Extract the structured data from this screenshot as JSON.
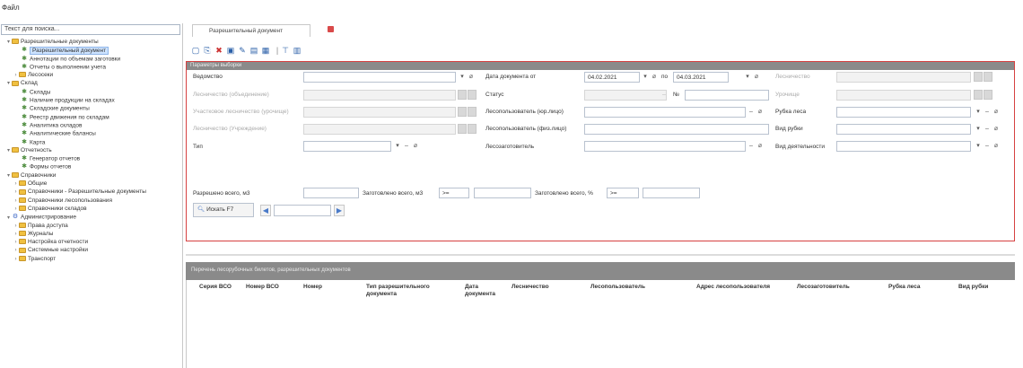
{
  "menu": {
    "file": "Файл"
  },
  "tree": {
    "search_placeholder": "Текст для поиска...",
    "items": [
      {
        "label": "Разрешительные документы",
        "type": "folder",
        "toggle": "▾"
      },
      {
        "label": "Разрешительный документ",
        "type": "page",
        "toggle": "",
        "selected": true
      },
      {
        "label": "Аннотации по объемам заготовки",
        "type": "page",
        "toggle": ""
      },
      {
        "label": "Отчеты о выполнении учета",
        "type": "page",
        "toggle": ""
      },
      {
        "label": "Лесосеки",
        "type": "folder",
        "toggle": "›"
      },
      {
        "label": "Склад",
        "type": "folder",
        "toggle": "▾"
      },
      {
        "label": "Склады",
        "type": "page",
        "toggle": ""
      },
      {
        "label": "Наличие продукции на складах",
        "type": "page",
        "toggle": ""
      },
      {
        "label": "Складские документы",
        "type": "page",
        "toggle": ""
      },
      {
        "label": "Реестр движения по складам",
        "type": "page",
        "toggle": ""
      },
      {
        "label": "Аналитика складов",
        "type": "page",
        "toggle": ""
      },
      {
        "label": "Аналитические балансы",
        "type": "page",
        "toggle": ""
      },
      {
        "label": "Карта",
        "type": "page",
        "toggle": ""
      },
      {
        "label": "Отчетность",
        "type": "folder",
        "toggle": "▾"
      },
      {
        "label": "Генератор отчетов",
        "type": "page",
        "toggle": ""
      },
      {
        "label": "Формы отчетов",
        "type": "page",
        "toggle": ""
      },
      {
        "label": "Справочники",
        "type": "folder",
        "toggle": "▾"
      },
      {
        "label": "Общие",
        "type": "folder",
        "toggle": "›"
      },
      {
        "label": "Справочники - Разрешительные документы",
        "type": "folder",
        "toggle": "›"
      },
      {
        "label": "Справочники лесопользования",
        "type": "folder",
        "toggle": "›"
      },
      {
        "label": "Справочники складов",
        "type": "folder",
        "toggle": "›"
      },
      {
        "label": "Администрирование",
        "type": "admin",
        "toggle": "▾"
      },
      {
        "label": "Права доступа",
        "type": "folder",
        "toggle": "›"
      },
      {
        "label": "Журналы",
        "type": "folder",
        "toggle": "›"
      },
      {
        "label": "Настройка отчетности",
        "type": "folder",
        "toggle": "›"
      },
      {
        "label": "Системные настройки",
        "type": "folder",
        "toggle": "›"
      },
      {
        "label": "Транспорт",
        "type": "folder",
        "toggle": "›"
      }
    ]
  },
  "tab": {
    "label": "Разрешительный документ"
  },
  "filter": {
    "header": "Параметры выборки",
    "col1": {
      "vedomstvo": "Ведомство",
      "dis1": "Лесничество (объединение)",
      "dis2": "Участковое лесничество (урочище)",
      "dis3": "Лесничество (Учреждение)",
      "type": "Тип"
    },
    "col2": {
      "date_from": "Дата документа от",
      "date_from_val": "04.02.2021",
      "date_to_label": "по",
      "date_to_val": "04.03.2021",
      "status": "Статус",
      "number_label": "№",
      "lesopolz_jur": "Лесопользователь (юр.лицо)",
      "lesopolz_fiz": "Лесопользователь (физ.лицо)",
      "lesozagot": "Лесозаготовитель"
    },
    "col3": {
      "dis1": "Лесничество",
      "dis2": "Урочище",
      "rubka": "Рубка леса",
      "vid_rubki": "Вид рубки",
      "vid_deyat": "Вид деятельности"
    },
    "row_volume": {
      "razresheno": "Разрешено всего, м3",
      "zagotovleno_m3": "Заготовлено всего, м3",
      "op1": ">=",
      "zagotovleno_pct": "Заготовлено всего, %",
      "op2": ">="
    },
    "search_button": "Искать F7"
  },
  "results": {
    "header": "Перечень лесорубочных билетов, разрешительных документов",
    "columns": [
      "Серия ВСО",
      "Номер ВСО",
      "Номер",
      "Тип разрешительного документа",
      "Дата документа",
      "Лесничество",
      "Лесопользователь",
      "Адрес лесопользователя",
      "Лесозаготовитель",
      "Рубка леса",
      "Вид рубки"
    ]
  }
}
